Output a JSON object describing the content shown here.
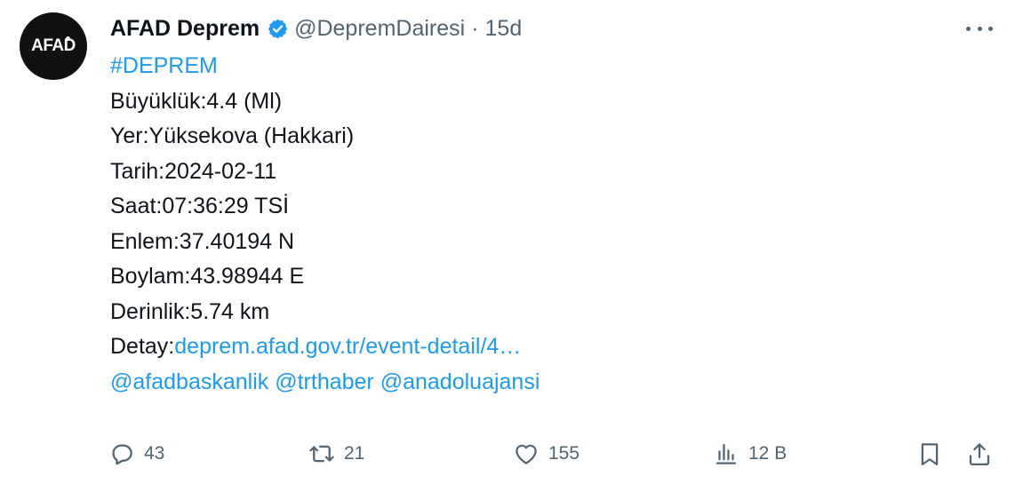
{
  "author": {
    "avatar_text": "AFAD",
    "display_name": "AFAD Deprem",
    "handle": "@DepremDairesi",
    "separator": "·",
    "time": "15d"
  },
  "post": {
    "hashtag": "#DEPREM",
    "magnitude": "Büyüklük:4.4 (Ml)",
    "location": "Yer:Yüksekova (Hakkari)",
    "date": "Tarih:2024-02-11",
    "time": "Saat:07:36:29 TSİ",
    "latitude": "Enlem:37.40194 N",
    "longitude": "Boylam:43.98944 E",
    "depth": "Derinlik:5.74 km",
    "detail_label": "Detay:",
    "detail_link": "deprem.afad.gov.tr/event-detail/4…",
    "mention_1": "@afadbaskanlik",
    "mention_2": "@trthaber",
    "mention_3": "@anadoluajansi"
  },
  "actions": {
    "replies": "43",
    "reposts": "21",
    "likes": "155",
    "views": "12 B"
  },
  "colors": {
    "link": "#1d9bf0",
    "verified": "#1d9bf0",
    "secondary_text": "#536471"
  },
  "icons": [
    "verified-badge-icon",
    "more-icon",
    "reply-icon",
    "repost-icon",
    "like-icon",
    "views-icon",
    "bookmark-icon",
    "share-icon"
  ]
}
